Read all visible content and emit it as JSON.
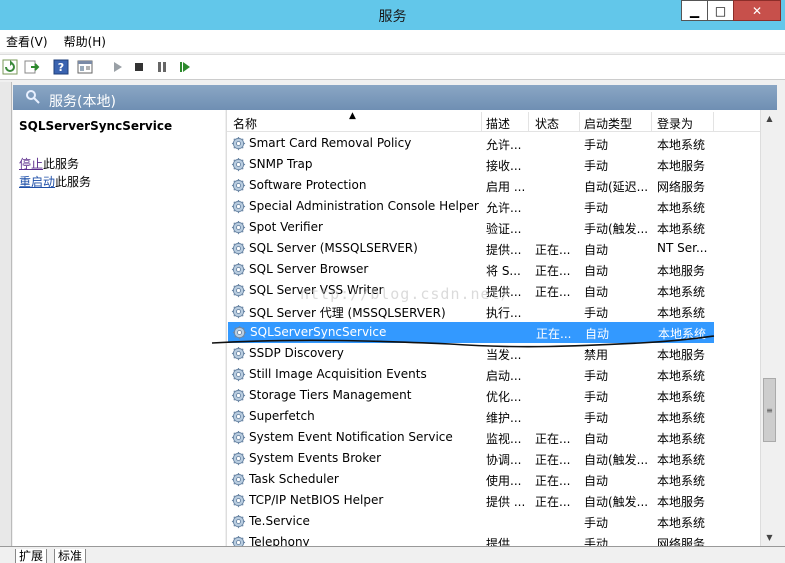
{
  "window": {
    "title": "服务"
  },
  "menu": {
    "items": [
      "查看(V)",
      "帮助(H)"
    ]
  },
  "header": {
    "title": "服务(本地)"
  },
  "left_panel": {
    "service_name": "SQLServerSyncService",
    "stop_link": "停止",
    "stop_suffix": "此服务",
    "restart_link": "重启动",
    "restart_suffix": "此服务"
  },
  "columns": [
    "名称",
    "描述",
    "状态",
    "启动类型",
    "登录为"
  ],
  "rows": [
    {
      "name": "Smart Card Removal Policy",
      "desc": "允许...",
      "status": "",
      "startup": "手动",
      "logon": "本地系统"
    },
    {
      "name": "SNMP Trap",
      "desc": "接收...",
      "status": "",
      "startup": "手动",
      "logon": "本地服务"
    },
    {
      "name": "Software Protection",
      "desc": "启用 ...",
      "status": "",
      "startup": "自动(延迟...",
      "logon": "网络服务"
    },
    {
      "name": "Special Administration Console Helper",
      "desc": "允许...",
      "status": "",
      "startup": "手动",
      "logon": "本地系统"
    },
    {
      "name": "Spot Verifier",
      "desc": "验证...",
      "status": "",
      "startup": "手动(触发...",
      "logon": "本地系统"
    },
    {
      "name": "SQL Server (MSSQLSERVER)",
      "desc": "提供...",
      "status": "正在...",
      "startup": "自动",
      "logon": "NT Ser..."
    },
    {
      "name": "SQL Server Browser",
      "desc": "将 S...",
      "status": "正在...",
      "startup": "自动",
      "logon": "本地服务"
    },
    {
      "name": "SQL Server VSS Writer",
      "desc": "提供...",
      "status": "正在...",
      "startup": "自动",
      "logon": "本地系统"
    },
    {
      "name": "SQL Server 代理 (MSSQLSERVER)",
      "desc": "执行...",
      "status": "",
      "startup": "手动",
      "logon": "本地系统"
    },
    {
      "name": "SQLServerSyncService",
      "desc": "",
      "status": "正在...",
      "startup": "自动",
      "logon": "本地系统"
    },
    {
      "name": "SSDP Discovery",
      "desc": "当发...",
      "status": "",
      "startup": "禁用",
      "logon": "本地服务"
    },
    {
      "name": "Still Image Acquisition Events",
      "desc": "启动...",
      "status": "",
      "startup": "手动",
      "logon": "本地系统"
    },
    {
      "name": "Storage Tiers Management",
      "desc": "优化...",
      "status": "",
      "startup": "手动",
      "logon": "本地系统"
    },
    {
      "name": "Superfetch",
      "desc": "维护...",
      "status": "",
      "startup": "手动",
      "logon": "本地系统"
    },
    {
      "name": "System Event Notification Service",
      "desc": "监视...",
      "status": "正在...",
      "startup": "自动",
      "logon": "本地系统"
    },
    {
      "name": "System Events Broker",
      "desc": "协调...",
      "status": "正在...",
      "startup": "自动(触发...",
      "logon": "本地系统"
    },
    {
      "name": "Task Scheduler",
      "desc": "使用...",
      "status": "正在...",
      "startup": "自动",
      "logon": "本地系统"
    },
    {
      "name": "TCP/IP NetBIOS Helper",
      "desc": "提供 ...",
      "status": "正在...",
      "startup": "自动(触发...",
      "logon": "本地服务"
    },
    {
      "name": "Te.Service",
      "desc": "",
      "status": "",
      "startup": "手动",
      "logon": "本地系统"
    },
    {
      "name": "Telephony",
      "desc": "提供...",
      "status": "",
      "startup": "手动",
      "logon": "网络服务"
    }
  ],
  "selected_row_index": 9,
  "watermark": "http://blog.csdn.net/",
  "tabs": [
    "扩展",
    "标准"
  ],
  "colors": {
    "titlebar": "#62c7ea",
    "selection": "#3399ff",
    "header_band": "#7a98ba"
  }
}
